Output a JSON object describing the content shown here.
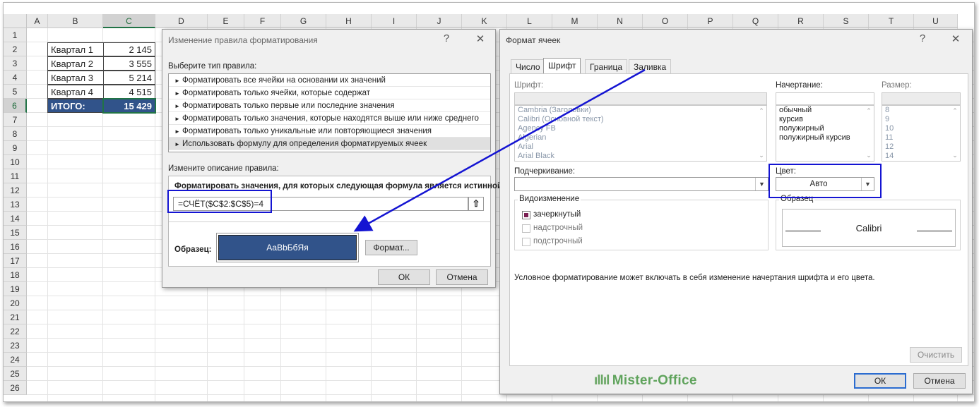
{
  "spreadsheet": {
    "columns": [
      "A",
      "B",
      "C",
      "D",
      "E",
      "F",
      "G",
      "H",
      "I",
      "J",
      "K",
      "L",
      "M",
      "N",
      "O",
      "P",
      "Q",
      "R",
      "S",
      "T",
      "U"
    ],
    "rows": [
      "1",
      "2",
      "3",
      "4",
      "5",
      "6",
      "7",
      "8",
      "9",
      "10",
      "11",
      "12",
      "13",
      "14",
      "15",
      "16",
      "17",
      "18",
      "19",
      "20",
      "21",
      "22",
      "23",
      "24",
      "25",
      "26"
    ],
    "table": [
      {
        "label": "Квартал 1",
        "value": "2 145"
      },
      {
        "label": "Квартал 2",
        "value": "3 555"
      },
      {
        "label": "Квартал 3",
        "value": "5 214"
      },
      {
        "label": "Квартал 4",
        "value": "4 515"
      }
    ],
    "total": {
      "label": "ИТОГО:",
      "value": "15 429"
    },
    "colors": {
      "total_fill": "#31538a",
      "selection": "#217346"
    }
  },
  "rule_dialog": {
    "title": "Изменение правила форматирования",
    "help": "?",
    "close": "✕",
    "rule_type_label": "Выберите тип правила:",
    "rule_types": [
      "Форматировать все ячейки на основании их значений",
      "Форматировать только ячейки, которые содержат",
      "Форматировать только первые или последние значения",
      "Форматировать только значения, которые находятся выше или ниже среднего",
      "Форматировать только уникальные или повторяющиеся значения",
      "Использовать формулу для определения форматируемых ячеек"
    ],
    "selected_rule_index": 5,
    "edit_label": "Измените описание правила:",
    "formula_label": "Форматировать значения, для которых следующая формула является истинной:",
    "formula_value": "=СЧЁТ($C$2:$C$5)=4",
    "sample_label": "Образец:",
    "sample_text": "АаВbБбЯя",
    "format_button": "Формат...",
    "ok": "ОК",
    "cancel": "Отмена"
  },
  "format_dialog": {
    "title": "Формат ячеек",
    "help": "?",
    "close": "✕",
    "tabs": [
      "Число",
      "Шрифт",
      "Граница",
      "Заливка"
    ],
    "active_tab": "Шрифт",
    "font_label": "Шрифт:",
    "fonts": [
      "Cambria (Заголовки)",
      "Calibri (Основной текст)",
      "Agency FB",
      "Algerian",
      "Arial",
      "Arial Black"
    ],
    "style_label": "Начертание:",
    "styles": [
      "обычный",
      "курсив",
      "полужирный",
      "полужирный курсив"
    ],
    "size_label": "Размер:",
    "sizes": [
      "8",
      "9",
      "10",
      "11",
      "12",
      "14"
    ],
    "underline_label": "Подчеркивание:",
    "color_label": "Цвет:",
    "color_value": "Авто",
    "effects_label": "Видоизменение",
    "effects": [
      {
        "label": "зачеркнутый",
        "checked": true,
        "enabled": true
      },
      {
        "label": "надстрочный",
        "checked": false,
        "enabled": false
      },
      {
        "label": "подстрочный",
        "checked": false,
        "enabled": false
      }
    ],
    "preview_label": "Образец",
    "preview_text": "Calibri",
    "note": "Условное форматирование может включать в себя изменение начертания шрифта и его цвета.",
    "clear_button": "Очистить",
    "ok": "ОК",
    "cancel": "Отмена"
  },
  "annotation_color": "#1414d2",
  "watermark": "Mister-Office"
}
